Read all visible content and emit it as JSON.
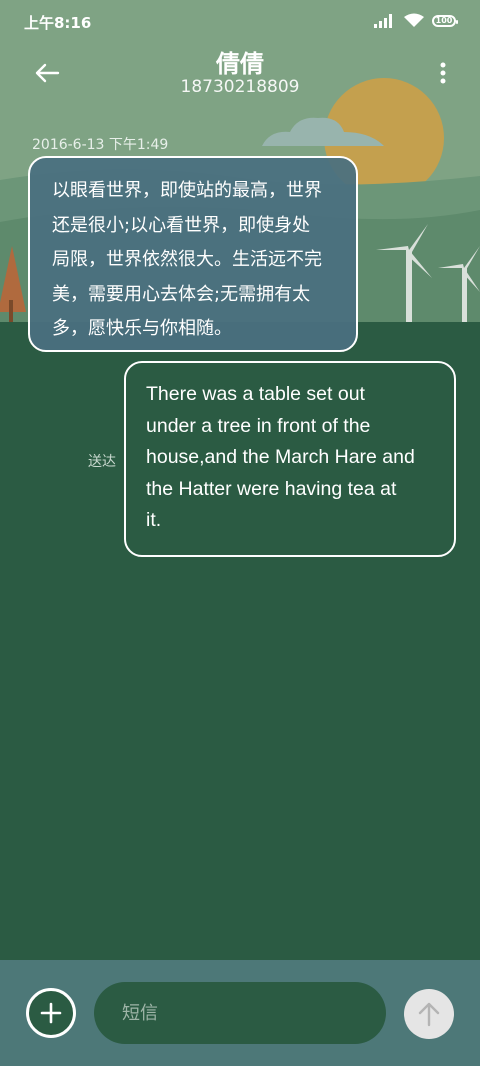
{
  "status_bar": {
    "time": "上午8:16",
    "battery": "100",
    "icons": [
      "signal-icon",
      "wifi-icon",
      "battery-icon"
    ]
  },
  "header": {
    "contact_name": "倩倩",
    "phone_number": "18730218809",
    "icons": [
      "back-arrow-icon",
      "more-vertical-icon"
    ]
  },
  "messages": {
    "timestamp": "2016-6-13 下午1:49",
    "received": {
      "lines": [
        "以眼看世界，即使站的最高，世界",
        "还是很小;以心看世界，即使身处",
        "局限，世界依然很大。生活远不完",
        "美，需要用心去体会;无需拥有太",
        "多，愿快乐与你相随。"
      ]
    },
    "sent": {
      "lines": [
        "There was a table set out",
        "under a tree in front of the",
        "house,and the March Hare and",
        "the Hatter were having tea at",
        "it."
      ],
      "status": "送达"
    }
  },
  "composer": {
    "placeholder": "短信",
    "icons": [
      "plus-icon",
      "send-arrow-icon"
    ]
  },
  "colors": {
    "sky": "#7fa384",
    "chat_background": "#2b5b43",
    "received_bubble": "#4a7080",
    "bottom_bar": "#4d7878",
    "sun": "#c4a04e"
  }
}
